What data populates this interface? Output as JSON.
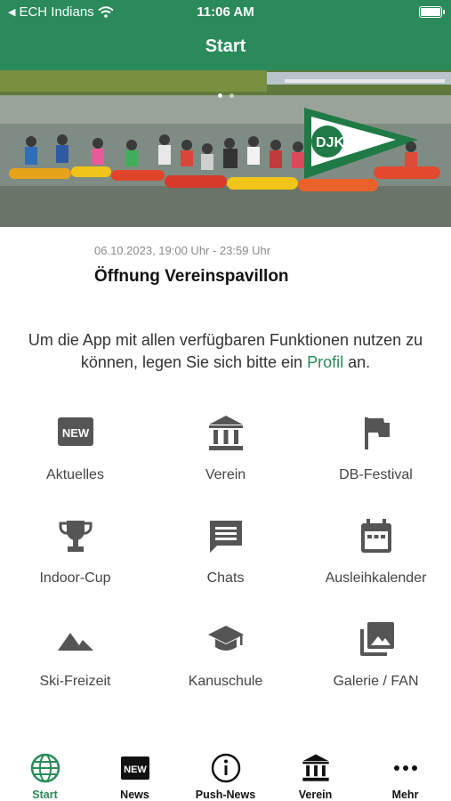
{
  "status_bar": {
    "carrier": "ECH Indians",
    "time": "11:06 AM"
  },
  "header": {
    "title": "Start"
  },
  "event": {
    "date": "06.10.2023, 19:00 Uhr - 23:59 Uhr",
    "title": "Öffnung Vereinspavillon"
  },
  "profile_prompt": {
    "text_before": "Um die App mit allen verfügbaren Funktionen nutzen zu können, legen Sie sich bitte ein ",
    "link": "Profil",
    "text_after": " an."
  },
  "tiles": [
    {
      "label": "Aktuelles",
      "icon": "new-badge-icon"
    },
    {
      "label": "Verein",
      "icon": "institution-icon"
    },
    {
      "label": "DB-Festival",
      "icon": "flag-icon"
    },
    {
      "label": "Indoor-Cup",
      "icon": "trophy-icon"
    },
    {
      "label": "Chats",
      "icon": "chat-icon"
    },
    {
      "label": "Ausleihkalender",
      "icon": "calendar-icon"
    },
    {
      "label": "Ski-Freizeit",
      "icon": "mountains-icon"
    },
    {
      "label": "Kanuschule",
      "icon": "graduation-cap-icon"
    },
    {
      "label": "Galerie / FAN",
      "icon": "photo-library-icon"
    }
  ],
  "tabbar": [
    {
      "label": "Start",
      "icon": "globe-icon",
      "active": true
    },
    {
      "label": "News",
      "icon": "new-badge-icon"
    },
    {
      "label": "Push-News",
      "icon": "info-icon"
    },
    {
      "label": "Verein",
      "icon": "institution-icon"
    },
    {
      "label": "Mehr",
      "icon": "more-dots-icon"
    }
  ],
  "colors": {
    "primary": "#2a8a5a",
    "icon_gray": "#555555"
  }
}
